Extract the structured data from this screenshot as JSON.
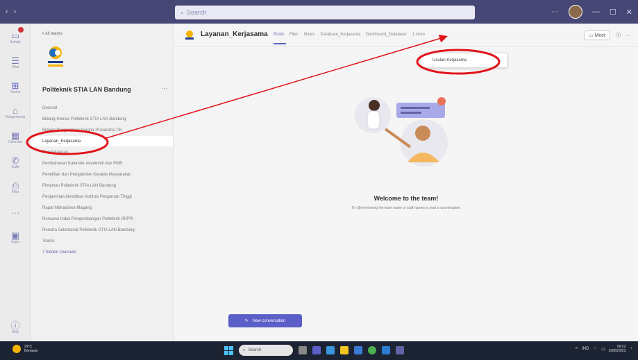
{
  "titlebar": {
    "search_placeholder": "Search",
    "controls": [
      "—",
      "☐",
      "✕"
    ]
  },
  "rail": {
    "items": [
      {
        "label": "Activity",
        "icon": "bell-icon",
        "glyph": "🔔",
        "badge": true
      },
      {
        "label": "Chat",
        "icon": "chat-icon",
        "glyph": "☰"
      },
      {
        "label": "Teams",
        "icon": "teams-icon",
        "glyph": "⊞",
        "active": true
      },
      {
        "label": "Assignments",
        "icon": "assignments-icon",
        "glyph": "⌂"
      },
      {
        "label": "Calendar",
        "icon": "calendar-icon",
        "glyph": "▦"
      },
      {
        "label": "Calls",
        "icon": "phone-icon",
        "glyph": "✆"
      },
      {
        "label": "Files",
        "icon": "file-icon",
        "glyph": "⎙"
      },
      {
        "label": "...",
        "icon": "more-icon",
        "glyph": "···"
      },
      {
        "label": "Apps",
        "icon": "apps-icon",
        "glyph": "▣"
      },
      {
        "label": "Help",
        "icon": "help-icon",
        "glyph": "ⓘ"
      }
    ]
  },
  "sidebar": {
    "back_label": "< All teams",
    "team_name": "Politeknik STIA LAN Bandung",
    "team_more": "···",
    "channels": [
      {
        "label": "General"
      },
      {
        "label": "Bidang Humas Politeknik STIA LAN Bandung"
      },
      {
        "label": "Bidang Pengelolaan Sarana Prasarana TIK"
      },
      {
        "label": "Layanan_Kerjasama",
        "active": true
      },
      {
        "label": "Pembelajaran"
      },
      {
        "label": "Pembahasan Kalender Akademik dan PMB"
      },
      {
        "label": "Penelitian dan Pengabdian Kepada Masyarakat"
      },
      {
        "label": "Pimpinan Politeknik STIA LAN Bandung"
      },
      {
        "label": "Penjaminan Akreditasi Institusi Perguruan Tinggi"
      },
      {
        "label": "Rapat Mahasiswa Magang"
      },
      {
        "label": "Rencana Induk Pengembangan Politeknik (RIPP)"
      },
      {
        "label": "Renstra Sekretariat Politeknik STIA LAN Bandung"
      },
      {
        "label": "Teams"
      },
      {
        "label": "7 hidden channels",
        "hidden": true
      }
    ]
  },
  "main": {
    "channel_title": "Layanan_Kerjasama",
    "tabs": [
      "Posts",
      "Files",
      "Notes",
      "Database_Kerjasama",
      "Dashboard_Database",
      "1 more"
    ],
    "meet_label": "Meet",
    "dropdown_item": "Usulan Kerjasama",
    "welcome_title": "Welcome to the team!",
    "welcome_sub": "Try @mentioning the team name or staff names to start a conversation.",
    "new_conversation": "New conversation"
  },
  "taskbar": {
    "weather_temp": "29°C",
    "weather_desc": "Berawan",
    "search_label": "Search",
    "time": "09:22",
    "date": "19/05/2023",
    "lang": "IND"
  },
  "colors": {
    "titlebar": "#464775",
    "accent": "#5b5fc7",
    "annotation": "#e0141a"
  }
}
